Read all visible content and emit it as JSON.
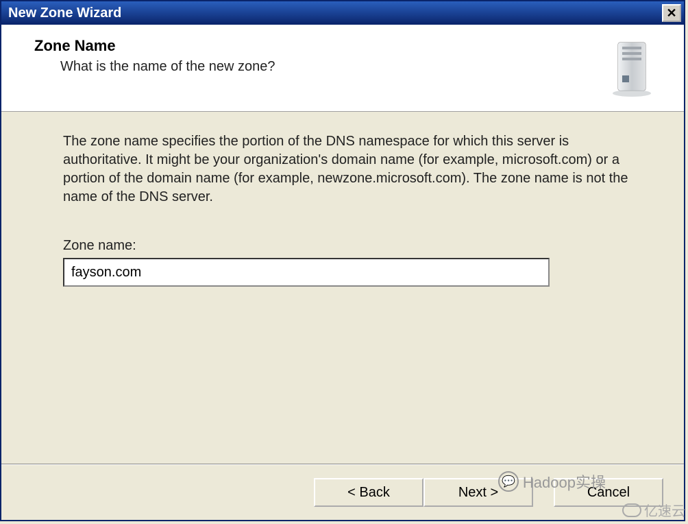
{
  "titlebar": {
    "title": "New Zone Wizard",
    "close_glyph": "✕"
  },
  "header": {
    "heading": "Zone Name",
    "subheading": "What is the name of the new zone?"
  },
  "body": {
    "description": "The zone name specifies the portion of the DNS namespace for which this server is authoritative. It might be your organization's domain name (for example,  microsoft.com) or a portion of the domain name (for example, newzone.microsoft.com). The zone name is not the name of the DNS server.",
    "field_label": "Zone name:",
    "zone_value": "fayson.com"
  },
  "buttons": {
    "back": "< Back",
    "next": "Next >",
    "cancel": "Cancel"
  },
  "watermarks": {
    "chat": "Hadoop实操",
    "corner": "亿速云"
  }
}
